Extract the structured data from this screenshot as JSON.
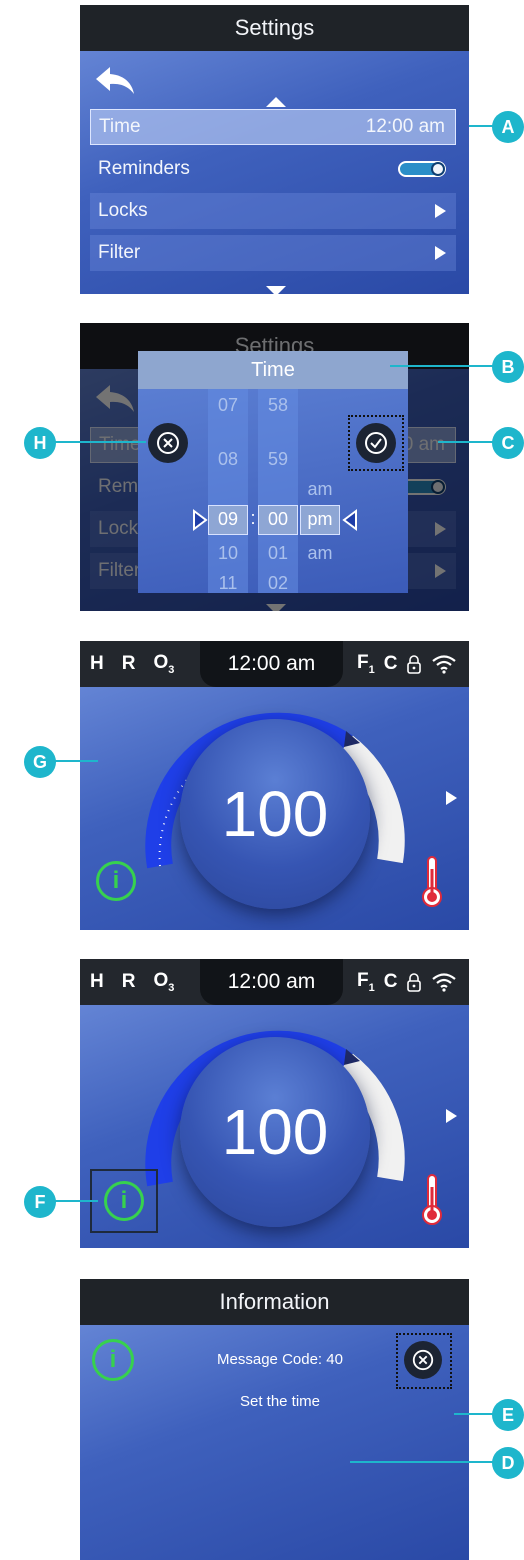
{
  "settings": {
    "title": "Settings",
    "rows": [
      {
        "label": "Time",
        "value": "12:00 am"
      },
      {
        "label": "Reminders"
      },
      {
        "label": "Locks"
      },
      {
        "label": "Filter"
      }
    ]
  },
  "time_dialog": {
    "title": "Time",
    "hours": [
      "07",
      "08",
      "09",
      "10",
      "11"
    ],
    "minutes": [
      "58",
      "59",
      "00",
      "01",
      "02"
    ],
    "ampm": [
      "am",
      "pm",
      "am"
    ],
    "colon": ":"
  },
  "home": {
    "status_left": [
      "H",
      "R"
    ],
    "ozone": {
      "base": "O",
      "sub": "3"
    },
    "time": "12:00 am",
    "filter": {
      "base": "F",
      "sub": "1"
    },
    "unit": "C",
    "temperature": "100",
    "info_glyph": "i"
  },
  "information": {
    "title": "Information",
    "message_code": "Message Code: 40",
    "message": "Set the time",
    "info_glyph": "i"
  },
  "callouts": [
    "A",
    "B",
    "C",
    "D",
    "E",
    "F",
    "G",
    "H"
  ],
  "colors": {
    "accent": "#1eb6cc",
    "info_green": "#37d14e",
    "dial_blue": "#1f3fe8",
    "thermo_red": "#e02a3a"
  }
}
